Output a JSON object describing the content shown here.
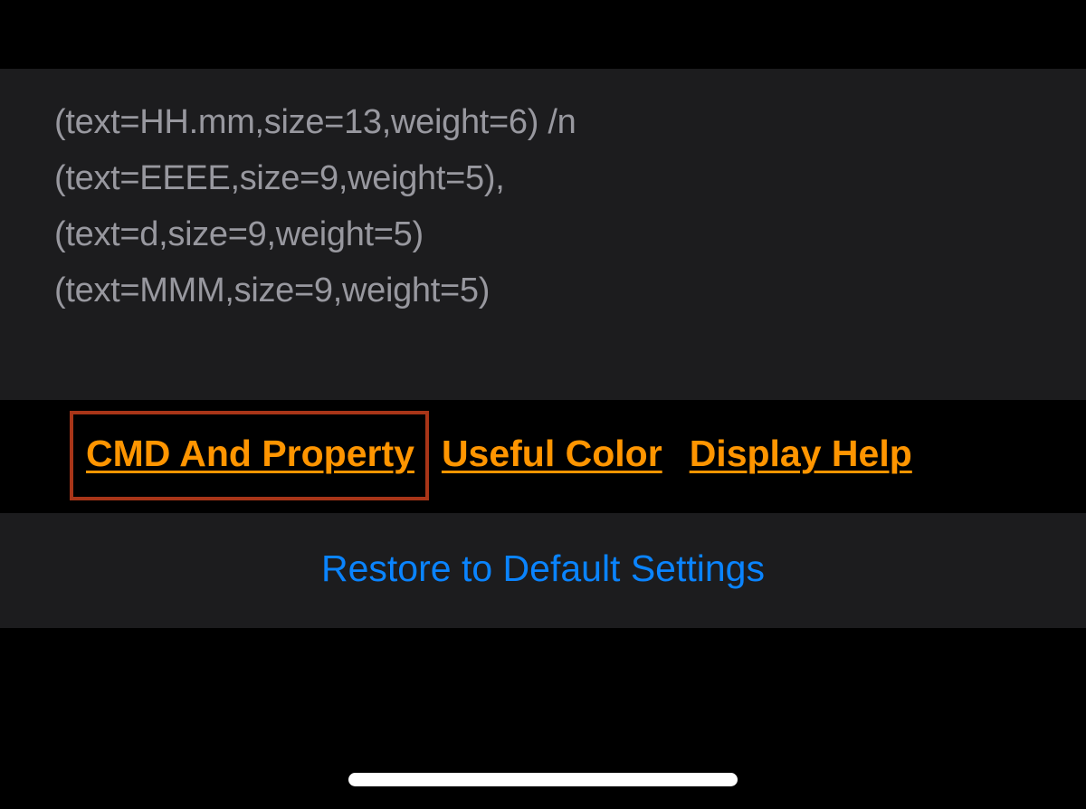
{
  "config": {
    "lines": [
      "(text=HH.mm,size=13,weight=6) /n",
      "(text=EEEE,size=9,weight=5),",
      "(text=d,size=9,weight=5)",
      "(text=MMM,size=9,weight=5)"
    ]
  },
  "links": {
    "cmd_property": "CMD And Property",
    "useful_color": "Useful Color",
    "display_help": "Display Help"
  },
  "restore": {
    "label": "Restore to Default Settings"
  }
}
